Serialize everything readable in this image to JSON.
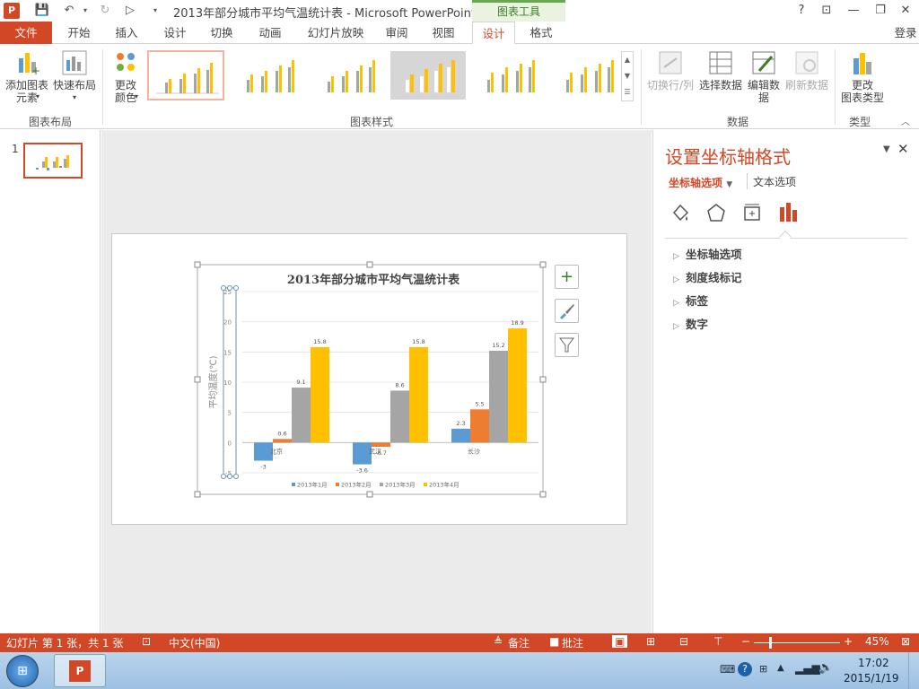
{
  "window": {
    "title": "2013年部分城市平均气温统计表 - Microsoft PowerPoint",
    "context_tool": "图表工具"
  },
  "winbtns": {
    "help": "?",
    "ribbon": "⊡",
    "min": "—",
    "max": "❐",
    "close": "✕"
  },
  "tabs": [
    "文件",
    "开始",
    "插入",
    "设计",
    "切换",
    "动画",
    "幻灯片放映",
    "审阅",
    "视图",
    "设计",
    "格式"
  ],
  "login": "登录",
  "ribbon": {
    "add_element": "添加图表\n元素",
    "quick_layout": "快速布局",
    "change_color": "更改\n颜色",
    "group_layout": "图表布局",
    "group_styles": "图表样式",
    "switch_rowcol": "切换行/列",
    "select_data": "选择数据",
    "edit_data": "编辑数\n据",
    "refresh_data": "刷新数据",
    "group_data": "数据",
    "change_type": "更改\n图表类型",
    "group_type": "类型"
  },
  "slide_number": "1",
  "pane": {
    "title": "设置坐标轴格式",
    "tab_axis": "坐标轴选项",
    "tab_text": "文本选项",
    "sections": [
      "坐标轴选项",
      "刻度线标记",
      "标签",
      "数字"
    ]
  },
  "status": {
    "slide_info": "幻灯片 第 1 张，共 1 张",
    "lang": "中文(中国)",
    "notes": "备注",
    "comments": "批注",
    "zoom": "45%"
  },
  "taskbar": {
    "time": "17:02",
    "date": "2015/1/19"
  },
  "colors": {
    "accent": "#d24726",
    "s1": "#5b9bd5",
    "s2": "#ed7d31",
    "s3": "#a5a5a5",
    "s4": "#ffc000"
  },
  "chart_data": {
    "type": "bar",
    "title": "2013年部分城市平均气温统计表",
    "ylabel": "平均温度(℃)",
    "xlabel": "",
    "categories": [
      "北京",
      "武汉",
      "长沙"
    ],
    "series": [
      {
        "name": "2013年1月",
        "values": [
          -3,
          -3.6,
          2.3
        ]
      },
      {
        "name": "2013年2月",
        "values": [
          0.6,
          -0.7,
          5.5
        ]
      },
      {
        "name": "2013年3月",
        "values": [
          9.1,
          8.6,
          15.2
        ]
      },
      {
        "name": "2013年4月",
        "values": [
          15.8,
          15.8,
          18.9
        ]
      }
    ],
    "data_labels": [
      [
        "-3",
        "0.6",
        "9.1",
        "15.8"
      ],
      [
        "-3.6",
        "-0.7",
        "8.6",
        "15.8"
      ],
      [
        "2.3",
        "5.5",
        "15.2",
        "18.9"
      ]
    ],
    "ylim": [
      -5,
      25
    ],
    "yticks": [
      "25",
      "20",
      "15",
      "10",
      "5",
      "0",
      "-5"
    ],
    "grid": true,
    "legend": "bottom"
  }
}
